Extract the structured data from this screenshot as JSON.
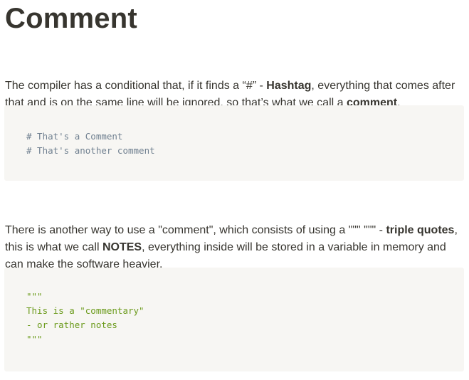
{
  "title": "Comment",
  "paragraph1": {
    "before": "The compiler has a conditional that, if it finds a “#” - ",
    "bold1": "Hashtag",
    "middle": ", everything that comes after that and is on the same line will be ignored, so that’s what we call a ",
    "bold2": "comment",
    "after": "."
  },
  "code_block1": {
    "line1": "# That's a Comment",
    "line2": "# That's another comment"
  },
  "paragraph2": {
    "before": "There is another way to use a \"comment\", which consists of using a \"\"\" \"\"\" - ",
    "bold1": "triple quotes",
    "middle": ", this is what we call ",
    "bold2": "NOTES",
    "after": ", everything inside will be stored in a variable in memory and can make the software heavier."
  },
  "code_block2": {
    "line1": "\"\"\"",
    "line2": "This is a \"commentary\"",
    "line3": "- or rather notes",
    "line4": "\"\"\""
  }
}
